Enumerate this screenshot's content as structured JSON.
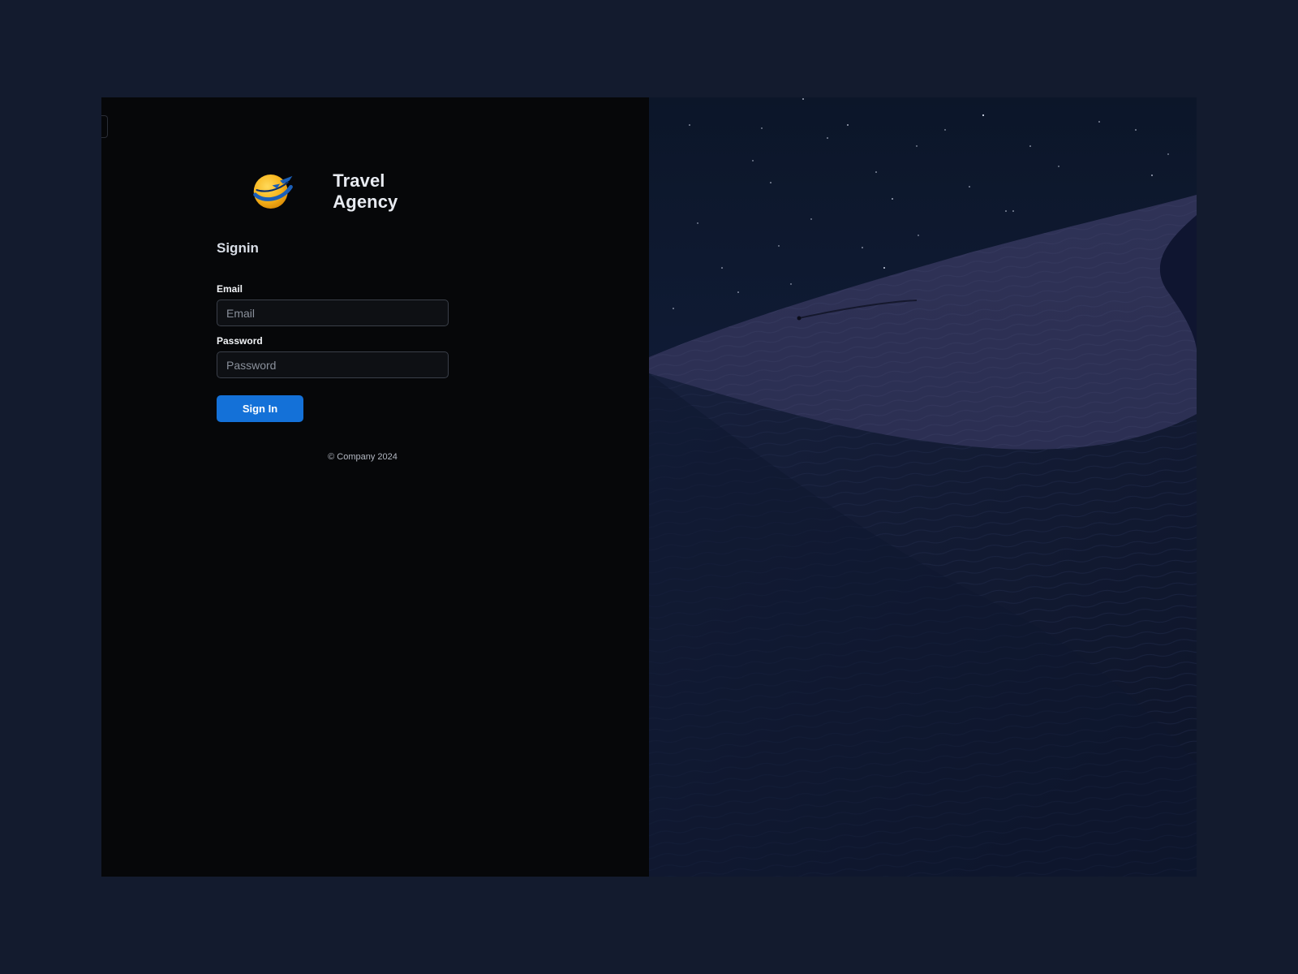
{
  "brand": {
    "name": "Travel Agency",
    "logo_icon": "globe-airplane-logo-icon"
  },
  "form": {
    "heading": "Signin",
    "email_label": "Email",
    "email_placeholder": "Email",
    "email_value": "",
    "password_label": "Password",
    "password_placeholder": "Password",
    "password_value": "",
    "submit_label": "Sign In"
  },
  "footer": {
    "copyright": "© Company 2024"
  },
  "hero": {
    "image": "night-desert-sand-dune-starry-sky"
  },
  "colors": {
    "page_background": "#131b2e",
    "panel_background": "#060709",
    "button_primary": "#1471d8",
    "text_primary": "#e8ebf1"
  }
}
